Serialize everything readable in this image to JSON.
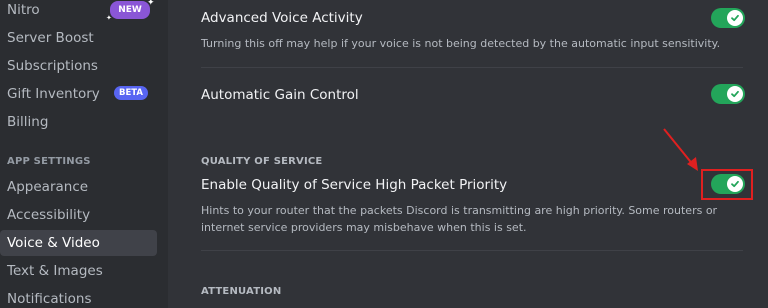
{
  "sidebar": {
    "items": [
      {
        "label": "Nitro",
        "badge": "NEW"
      },
      {
        "label": "Server Boost"
      },
      {
        "label": "Subscriptions"
      },
      {
        "label": "Gift Inventory",
        "badge": "BETA"
      },
      {
        "label": "Billing"
      }
    ],
    "section_header": "APP SETTINGS",
    "app_items": [
      {
        "label": "Appearance"
      },
      {
        "label": "Accessibility"
      },
      {
        "label": "Voice & Video",
        "selected": true
      },
      {
        "label": "Text & Images"
      },
      {
        "label": "Notifications"
      }
    ]
  },
  "settings": {
    "advanced_voice": {
      "title": "Advanced Voice Activity",
      "desc": "Turning this off may help if your voice is not being detected by the automatic input sensitivity.",
      "enabled": true
    },
    "gain_control": {
      "title": "Automatic Gain Control",
      "enabled": true
    },
    "qos_header": "QUALITY OF SERVICE",
    "qos": {
      "title": "Enable Quality of Service High Packet Priority",
      "desc": "Hints to your router that the packets Discord is transmitting are high priority. Some routers or internet service providers may misbehave when this is set.",
      "enabled": true
    },
    "attenuation_header": "ATTENUATION"
  },
  "colors": {
    "toggle_on": "#23a55a",
    "highlight": "#e02020",
    "new_badge": "#8a56d6",
    "beta_badge": "#5865f2"
  }
}
